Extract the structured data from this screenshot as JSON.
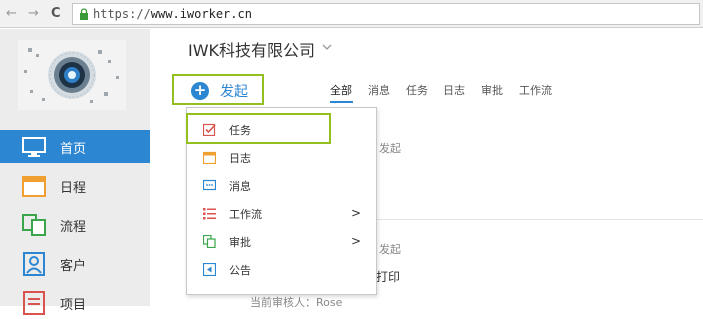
{
  "browser": {
    "back_glyph": "←",
    "forward_glyph": "→",
    "reload_glyph": "C",
    "url_scheme": "https://",
    "url_host": "www.iworker.cn"
  },
  "sidebar": {
    "items": [
      {
        "label": "首页",
        "icon": "monitor-icon"
      },
      {
        "label": "日程",
        "icon": "calendar-icon"
      },
      {
        "label": "流程",
        "icon": "flow-icon"
      },
      {
        "label": "客户",
        "icon": "customer-icon"
      },
      {
        "label": "项目",
        "icon": "project-icon"
      }
    ]
  },
  "header": {
    "company_name": "IWK科技有限公司"
  },
  "start_button": {
    "label": "发起",
    "plus_glyph": "+"
  },
  "tabs": [
    "全部",
    "消息",
    "任务",
    "日志",
    "审批",
    "工作流"
  ],
  "feed": {
    "item1_suffix": "发起",
    "item2_suffix": "发起",
    "item2_title_fragment": "打印",
    "item2_reviewer": "当前审核人：Rose"
  },
  "dropdown": {
    "items": [
      {
        "label": "任务",
        "icon": "task-check-icon"
      },
      {
        "label": "日志",
        "icon": "log-calendar-icon"
      },
      {
        "label": "消息",
        "icon": "message-icon"
      },
      {
        "label": "工作流",
        "icon": "workflow-list-icon"
      },
      {
        "label": "审批",
        "icon": "approval-copy-icon"
      },
      {
        "label": "公告",
        "icon": "announcement-icon"
      }
    ],
    "chevron_glyph": ">"
  },
  "colors": {
    "accent_blue": "#2d86d1",
    "highlight_green": "#93c01f",
    "task_red": "#d9534f",
    "log_orange": "#f0a030"
  }
}
